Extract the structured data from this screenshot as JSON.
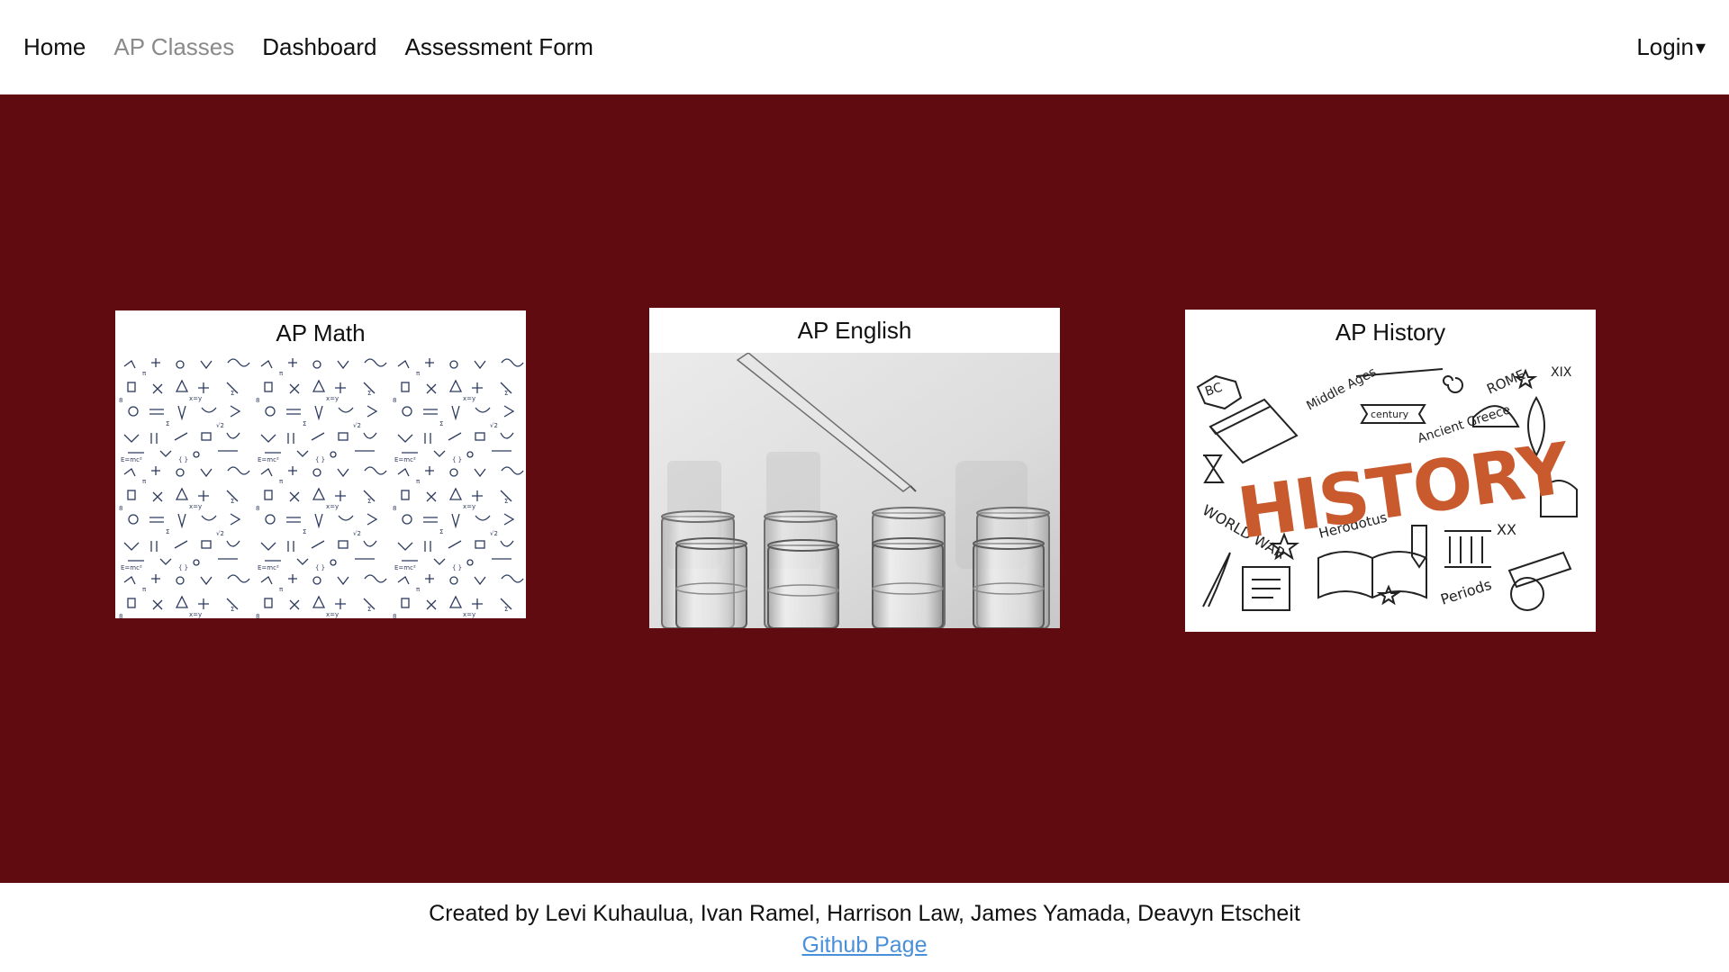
{
  "nav": {
    "links": [
      {
        "label": "Home",
        "active": false
      },
      {
        "label": "AP Classes",
        "active": true
      },
      {
        "label": "Dashboard",
        "active": false
      },
      {
        "label": "Assessment Form",
        "active": false
      }
    ],
    "login_label": "Login",
    "login_caret": "▾"
  },
  "cards": [
    {
      "title": "AP Math",
      "image": "math-formula-doodle-pattern"
    },
    {
      "title": "AP English",
      "image": "glass-test-tubes-pipette"
    },
    {
      "title": "AP History",
      "image": "history-doodle-illustration"
    }
  ],
  "history_image_text": {
    "headline": "HISTORY",
    "tags": [
      "BC",
      "Middle Ages",
      "century",
      "Ancient Greece",
      "ROME",
      "XIX",
      "WORLD WAR",
      "Herodotus",
      "XX",
      "Periods"
    ]
  },
  "footer": {
    "credits": "Created by Levi Kuhaulua, Ivan Ramel, Harrison Law, James Yamada, Deavyn Etscheit",
    "link_label": "Github Page"
  },
  "colors": {
    "main_background": "#600b10",
    "active_nav": "#8a8a8a",
    "link": "#4a90d9",
    "history_accent": "#c95a2e"
  }
}
